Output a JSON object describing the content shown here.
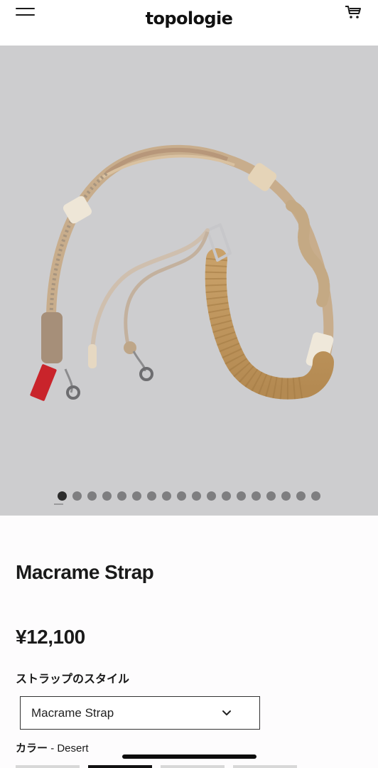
{
  "header": {
    "logo": "topologie",
    "menu_icon": "hamburger-menu-icon",
    "cart_icon": "cart-icon"
  },
  "gallery": {
    "image_subject": "macrame-strap-product-photo",
    "total_slides": 18,
    "active_slide": 1,
    "background_color": "#cdcdcf"
  },
  "product": {
    "title": "Macrame Strap",
    "price": "¥12,100"
  },
  "options": {
    "style_label": "ストラップのスタイル",
    "style_selected": "Macrame Strap",
    "color_label": "カラー",
    "color_value": "- Desert"
  }
}
